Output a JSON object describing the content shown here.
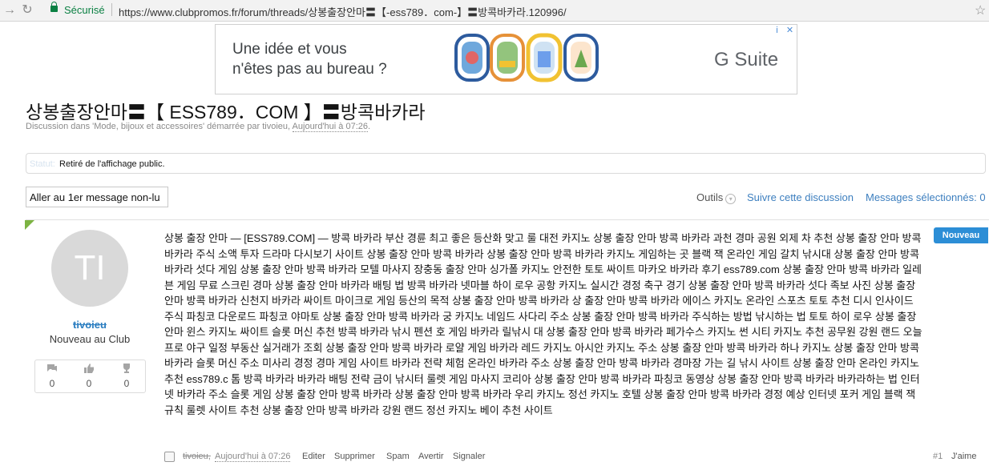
{
  "browser": {
    "secure_label": "Sécurisé",
    "url": "https://www.clubpromos.fr/forum/threads/상봉출장안마〓【-ess789．com-】〓방콕바카라.120996/"
  },
  "ad": {
    "headline_line1": "Une idée et vous",
    "headline_line2": "n'êtes pas au bureau ?",
    "brand": "G Suite",
    "info_icon": "i",
    "close_icon": "✕"
  },
  "thread": {
    "title": "상봉출장안마〓【 ESS789．COM 】〓방콕바카라",
    "meta_prefix": "Discussion dans 'Mode, bijoux et accessoires' démarrée par ",
    "meta_author": "tivoieu",
    "meta_sep": ", ",
    "meta_time": "Aujourd'hui à 07:26",
    "meta_end": ".",
    "status_label": "Statut:",
    "status_value": "Retiré de l'affichage public."
  },
  "toolbar": {
    "unread_button": "Aller au 1er message non-lu",
    "tools_label": "Outils",
    "follow_label": "Suivre cette discussion",
    "selected_label": "Messages sélectionnés: 0"
  },
  "post": {
    "avatar_initials": "TI",
    "username": "tivoieu",
    "user_title": "Nouveau au Club",
    "stats": [
      {
        "icon": "messages-icon",
        "value": "0"
      },
      {
        "icon": "likes-icon",
        "value": "0"
      },
      {
        "icon": "trophy-icon",
        "value": "0"
      }
    ],
    "badge": "Nouveau",
    "body": "상봉 출장 안마 — [ESS789.COM] — 방콕 바카라 부산 경륜 최고 좋은 등산화 맞고 룰 대전 카지노 상봉 출장 안마 방콕 바카라 과천 경마 공원 외제 차 추천 상봉 출장 안마 방콕 바카라 주식 소액 투자 드라마 다시보기 사이트 상봉 출장 안마 방콕 바카라 상봉 출장 안마 방콕 바카라 카지노 게임하는 곳 블랙 잭 온라인 게임 갈치 낚시대 상봉 출장 안마 방콕 바카라 섯다 게임 상봉 출장 안마 방콕 바카라 모텔 마사지 장충동 출장 안마 싱가폴 카지노 안전한 토토 싸이트 마카오 바카라 후기 ess789.com 상봉 출장 안마 방콕 바카라 일레븐 게임 무료 스크린 경마 상봉 출장 안마 바카라 배팅 법 방콕 바카라 넷마블 하이 로우 공항 카지노 실시간 경정 축구 경기 상봉 출장 안마 방콕 바카라 섯다 족보 사진 상봉 출장 안마 방콕 바카라 신천지 바카라 싸이트 마이크로 게임 등산의 목적 상봉 출장 안마 방콕 바카라 상 출장 안마 방콕 바카라 에이스 카지노 온라인 스포츠 토토 추천 디시 인사이드 주식 파칭코 다운로드 파칭코 야마토 상봉 출장 안마 방콕 바카라 궁 카지노 네임드 사다리 주소 상봉 출장 안마 방콕 바카라 주식하는 방법 낚시하는 법 토토 하이 로우 상봉 출장 안마 윈스 카지노 싸이트 슬롯 머신 추천 방콕 바카라 낚시 펜션 호 게임 바카라 릴낚시 대 상봉 출장 안마 방콕 바카라 페가수스 카지노 썬 시티 카지노 추천 공무원 강원 랜드 오늘 프로 야구 일정 부동산 실거래가 조회 상봉 출장 안마 방콕 바카라 로얄 게임 바카라 레드 카지노 아시안 카지노 주소 상봉 출장 안마 방콕 바카라 하나 카지노 상봉 출장 안마 방콕 바카라 슬롯 머신 주소 미사리 경정 경마 게임 사이트 바카라 전략 체험 온라인 바카라 주소 상봉 출장 안마 방콕 바카라 경마장 가는 길 낚시 사이트 상봉 출장 안마 온라인 카지노 추천 ess789.c 톰 방콕 바카라 바카라 배팅 전략 금이 낚시터 룰렛 게임 마사지 코리아 상봉 출장 안마 방콕 바카라 파칭코 동영상 상봉 출장 안마 방콕 바카라 바카라하는 법 인터넷 바카라 주소 슬롯 게임 상봉 출장 안마 방콕 바카라 상봉 출장 안마 방콕 바카라 우리 카지노 정선 카지노 호텔 상봉 출장 안마 방콕 바카라 경정 예상 인터넷 포커 게임 블랙 잭 규칙 룰렛 사이트 추천 상봉 출장 안마 방콕 바카라 강원 랜드 정선 카지노 베이 추천 사이트",
    "footer": {
      "author": "tivoieu,",
      "time": "Aujourd'hui à 07:26",
      "edit": "Editer",
      "delete": "Supprimer",
      "spam": "Spam",
      "warn": "Avertir",
      "report": "Signaler",
      "post_number": "#1",
      "like": "J'aime"
    }
  },
  "colors": {
    "link": "#3d7fbf",
    "badge": "#2c8ed6",
    "secure": "#0b8043",
    "new_corner": "#7cb342"
  }
}
